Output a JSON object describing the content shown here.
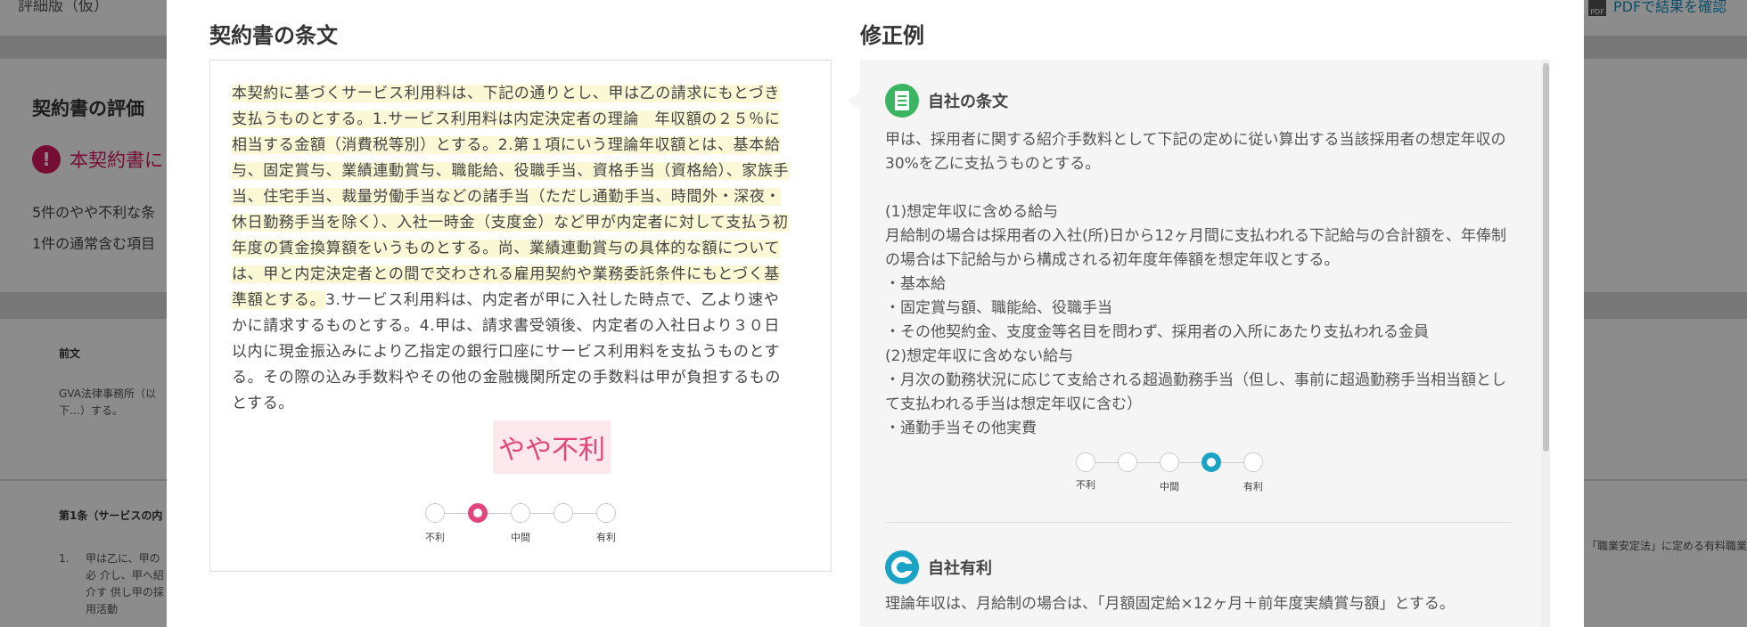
{
  "background": {
    "top_line": "評細版（仮）",
    "evaluation_title": "契約書の評価",
    "warning_icon": "!",
    "warning_text": "本契約書に",
    "summary_line_1": "5件のやや不利な条",
    "summary_line_2": "1件の通常含む項目",
    "preamble_heading": "前文",
    "preamble_text": "GVA法律事務所（以下…）する。",
    "article1_heading": "第1条（サービスの内",
    "article1_number": "1.",
    "article1_text": "甲は乙に、甲の必 介し、甲へ紹介す 供し甲の採用活動",
    "pdf_link": "PDFで結果を確認",
    "pdf_icon_label": "PDF",
    "right_note": "「職業安定法」に定める有料職業"
  },
  "modal": {
    "left_title": "契約書の条文",
    "right_title": "修正例",
    "clause_highlighted": "本契約に基づくサービス利用料は、下記の通りとし、甲は乙の請求にもとづき支払うものとする。1.サービス利用料は内定決定者の理論　年収額の２５％に相当する金額（消費税等別）とする。2.第１項にいう理論年収額とは、基本給与、固定賞与、業績連動賞与、職能給、役職手当、資格手当（資格給）、家族手当、住宅手当、裁量労働手当などの諸手当（ただし通勤手当、時間外・深夜・休日勤務手当を除く）、入社一時金（支度金）など甲が内定者に対して支払う初年度の賃金換算額をいうものとする。尚、業績連動賞与の具体的な額については、甲と内定決定者との間で交わされる雇用契約や業務委託条件にもとづく基準額とする。",
    "clause_plain": "3.サービス利用料は、内定者が甲に入社した時点で、乙より速やかに請求するものとする。4.甲は、請求書受領後、内定者の入社日より３０日以内に現金振込みにより乙指定の銀行口座にサービス利用料を支払うものとする。その際の込み手数料やその他の金融機関所定の手数料は甲が負担するものとする。",
    "rating_label": "やや不利",
    "scale_labels": {
      "left": "不利",
      "middle": "中間",
      "right": "有利"
    },
    "left_scale_selected": 2,
    "own_clause_title": "自社の条文",
    "own_clause_text": "甲は、採用者に関する紹介手数料として下記の定めに従い算出する当該採用者の想定年収の30%を乙に支払うものとする。\n\n(1)想定年収に含める給与\n月給制の場合は採用者の入社(所)日から12ヶ月間に支払われる下記給与の合計額を、年俸制の場合は下記給与から構成される初年度年俸額を想定年収とする。\n・基本給\n・固定賞与額、職能給、役職手当\n・その他契約金、支度金等名目を問わず、採用者の入所にあたり支払われる金員\n(2)想定年収に含めない給与\n・月次の勤務状況に応じて支給される超過勤務手当（但し、事前に超過勤務手当相当額として支払われる手当は想定年収に含む）\n・通勤手当その他実費",
    "right_scale_selected": 4,
    "own_favorable_title": "自社有利",
    "own_favorable_text": "理論年収は、月給制の場合は、「月額固定給×12ヶ月＋前年度実績賞与額」とする。",
    "colors": {
      "accent_pink": "#e2457a",
      "accent_blue": "#1ba3c6",
      "accent_green": "#3cb563",
      "highlight": "#fbf8d6"
    }
  }
}
